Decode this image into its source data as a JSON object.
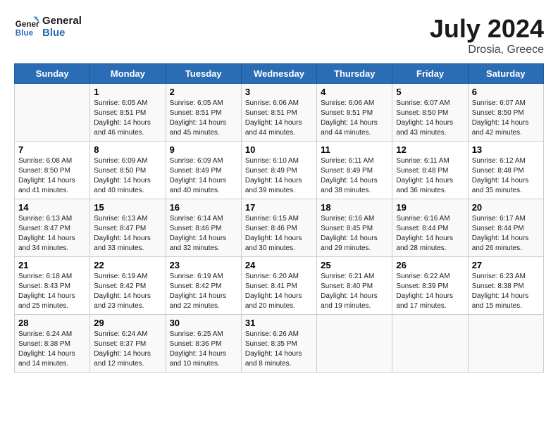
{
  "header": {
    "logo_line1": "General",
    "logo_line2": "Blue",
    "month_year": "July 2024",
    "location": "Drosia, Greece"
  },
  "weekdays": [
    "Sunday",
    "Monday",
    "Tuesday",
    "Wednesday",
    "Thursday",
    "Friday",
    "Saturday"
  ],
  "weeks": [
    [
      {
        "day": "",
        "info": ""
      },
      {
        "day": "1",
        "info": "Sunrise: 6:05 AM\nSunset: 8:51 PM\nDaylight: 14 hours\nand 46 minutes."
      },
      {
        "day": "2",
        "info": "Sunrise: 6:05 AM\nSunset: 8:51 PM\nDaylight: 14 hours\nand 45 minutes."
      },
      {
        "day": "3",
        "info": "Sunrise: 6:06 AM\nSunset: 8:51 PM\nDaylight: 14 hours\nand 44 minutes."
      },
      {
        "day": "4",
        "info": "Sunrise: 6:06 AM\nSunset: 8:51 PM\nDaylight: 14 hours\nand 44 minutes."
      },
      {
        "day": "5",
        "info": "Sunrise: 6:07 AM\nSunset: 8:50 PM\nDaylight: 14 hours\nand 43 minutes."
      },
      {
        "day": "6",
        "info": "Sunrise: 6:07 AM\nSunset: 8:50 PM\nDaylight: 14 hours\nand 42 minutes."
      }
    ],
    [
      {
        "day": "7",
        "info": "Sunrise: 6:08 AM\nSunset: 8:50 PM\nDaylight: 14 hours\nand 41 minutes."
      },
      {
        "day": "8",
        "info": "Sunrise: 6:09 AM\nSunset: 8:50 PM\nDaylight: 14 hours\nand 40 minutes."
      },
      {
        "day": "9",
        "info": "Sunrise: 6:09 AM\nSunset: 8:49 PM\nDaylight: 14 hours\nand 40 minutes."
      },
      {
        "day": "10",
        "info": "Sunrise: 6:10 AM\nSunset: 8:49 PM\nDaylight: 14 hours\nand 39 minutes."
      },
      {
        "day": "11",
        "info": "Sunrise: 6:11 AM\nSunset: 8:49 PM\nDaylight: 14 hours\nand 38 minutes."
      },
      {
        "day": "12",
        "info": "Sunrise: 6:11 AM\nSunset: 8:48 PM\nDaylight: 14 hours\nand 36 minutes."
      },
      {
        "day": "13",
        "info": "Sunrise: 6:12 AM\nSunset: 8:48 PM\nDaylight: 14 hours\nand 35 minutes."
      }
    ],
    [
      {
        "day": "14",
        "info": "Sunrise: 6:13 AM\nSunset: 8:47 PM\nDaylight: 14 hours\nand 34 minutes."
      },
      {
        "day": "15",
        "info": "Sunrise: 6:13 AM\nSunset: 8:47 PM\nDaylight: 14 hours\nand 33 minutes."
      },
      {
        "day": "16",
        "info": "Sunrise: 6:14 AM\nSunset: 8:46 PM\nDaylight: 14 hours\nand 32 minutes."
      },
      {
        "day": "17",
        "info": "Sunrise: 6:15 AM\nSunset: 8:46 PM\nDaylight: 14 hours\nand 30 minutes."
      },
      {
        "day": "18",
        "info": "Sunrise: 6:16 AM\nSunset: 8:45 PM\nDaylight: 14 hours\nand 29 minutes."
      },
      {
        "day": "19",
        "info": "Sunrise: 6:16 AM\nSunset: 8:44 PM\nDaylight: 14 hours\nand 28 minutes."
      },
      {
        "day": "20",
        "info": "Sunrise: 6:17 AM\nSunset: 8:44 PM\nDaylight: 14 hours\nand 26 minutes."
      }
    ],
    [
      {
        "day": "21",
        "info": "Sunrise: 6:18 AM\nSunset: 8:43 PM\nDaylight: 14 hours\nand 25 minutes."
      },
      {
        "day": "22",
        "info": "Sunrise: 6:19 AM\nSunset: 8:42 PM\nDaylight: 14 hours\nand 23 minutes."
      },
      {
        "day": "23",
        "info": "Sunrise: 6:19 AM\nSunset: 8:42 PM\nDaylight: 14 hours\nand 22 minutes."
      },
      {
        "day": "24",
        "info": "Sunrise: 6:20 AM\nSunset: 8:41 PM\nDaylight: 14 hours\nand 20 minutes."
      },
      {
        "day": "25",
        "info": "Sunrise: 6:21 AM\nSunset: 8:40 PM\nDaylight: 14 hours\nand 19 minutes."
      },
      {
        "day": "26",
        "info": "Sunrise: 6:22 AM\nSunset: 8:39 PM\nDaylight: 14 hours\nand 17 minutes."
      },
      {
        "day": "27",
        "info": "Sunrise: 6:23 AM\nSunset: 8:38 PM\nDaylight: 14 hours\nand 15 minutes."
      }
    ],
    [
      {
        "day": "28",
        "info": "Sunrise: 6:24 AM\nSunset: 8:38 PM\nDaylight: 14 hours\nand 14 minutes."
      },
      {
        "day": "29",
        "info": "Sunrise: 6:24 AM\nSunset: 8:37 PM\nDaylight: 14 hours\nand 12 minutes."
      },
      {
        "day": "30",
        "info": "Sunrise: 6:25 AM\nSunset: 8:36 PM\nDaylight: 14 hours\nand 10 minutes."
      },
      {
        "day": "31",
        "info": "Sunrise: 6:26 AM\nSunset: 8:35 PM\nDaylight: 14 hours\nand 8 minutes."
      },
      {
        "day": "",
        "info": ""
      },
      {
        "day": "",
        "info": ""
      },
      {
        "day": "",
        "info": ""
      }
    ]
  ]
}
